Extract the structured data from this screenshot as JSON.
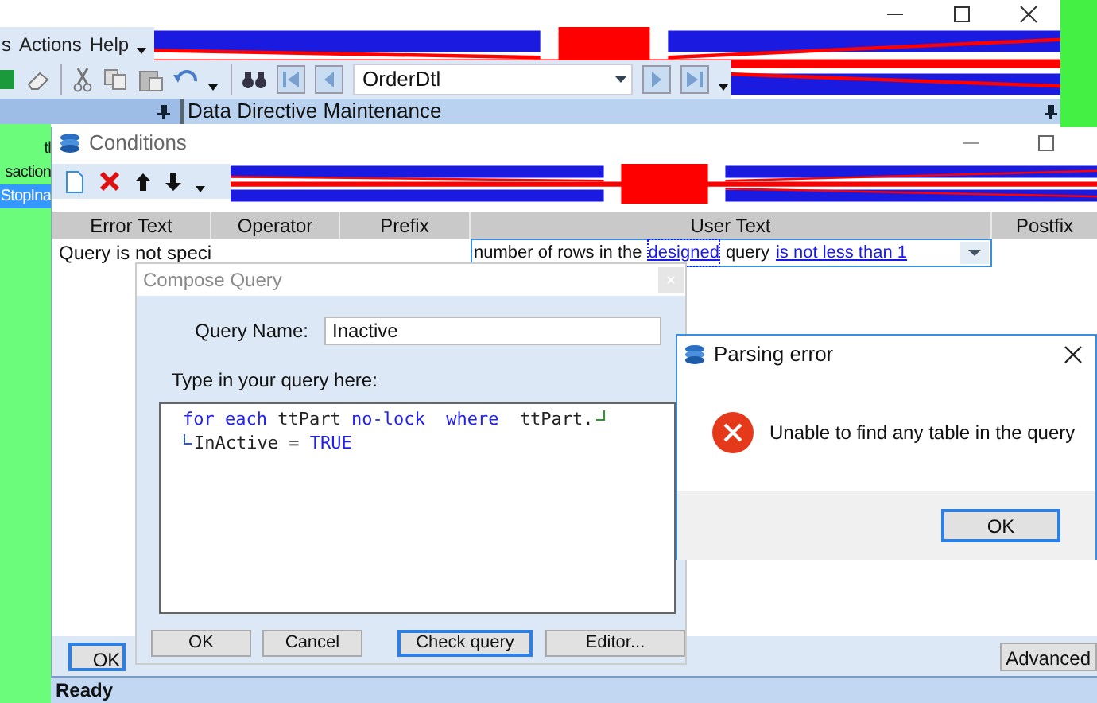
{
  "main_window": {
    "menu": [
      {
        "label": "s"
      },
      {
        "label": "Actions"
      },
      {
        "label": "Help"
      }
    ],
    "record_selector": {
      "value": "OrderDtl"
    },
    "left_panel": {
      "items": [
        {
          "label": "tl",
          "selected": false
        },
        {
          "label": "saction",
          "selected": false
        },
        {
          "label": "StopIna",
          "selected": true
        }
      ]
    },
    "document_title": "Data Directive Maintenance",
    "status_bar": "Ready"
  },
  "conditions": {
    "title": "Conditions",
    "columns": [
      "Error Text",
      "Operator",
      "Prefix",
      "User Text",
      "Postfix"
    ],
    "rows": [
      {
        "error_text": "Query is not speci",
        "user_text": [
          {
            "kind": "text",
            "text": "number of rows in the"
          },
          {
            "kind": "link",
            "text": "designed",
            "focused": true
          },
          {
            "kind": "text",
            "text": "query"
          },
          {
            "kind": "link",
            "text": "is not less than 1",
            "focused": false
          }
        ]
      }
    ],
    "buttons": [
      {
        "label": "OK",
        "focused": true
      },
      {
        "label": "Advanced",
        "focused": false
      }
    ]
  },
  "compose_query": {
    "title": "Compose Query",
    "active": false,
    "query_name_label": "Query Name:",
    "query_name": "Inactive",
    "editor_label": "Type in your query here:",
    "code_lines": [
      [
        {
          "kind": "keyword",
          "text": "for each"
        },
        {
          "kind": "plain",
          "text": " ttPart "
        },
        {
          "kind": "keyword",
          "text": "no-lock"
        },
        {
          "kind": "keyword",
          "text": "  where  "
        },
        {
          "kind": "plain",
          "text": "ttPart."
        },
        {
          "kind": "wrap_end"
        }
      ],
      [
        {
          "kind": "wrap_start"
        },
        {
          "kind": "plain",
          "text": "InActive = "
        },
        {
          "kind": "keyword",
          "text": "TRUE"
        }
      ]
    ],
    "buttons": [
      {
        "label": "OK",
        "focused": false
      },
      {
        "label": "Cancel",
        "focused": false
      },
      {
        "label": "Check query",
        "focused": true
      },
      {
        "label": "Editor...",
        "focused": false
      }
    ]
  },
  "parsing_error": {
    "title": "Parsing error",
    "message": "Unable to find any table in the query",
    "button": {
      "label": "OK",
      "focused": true
    }
  }
}
